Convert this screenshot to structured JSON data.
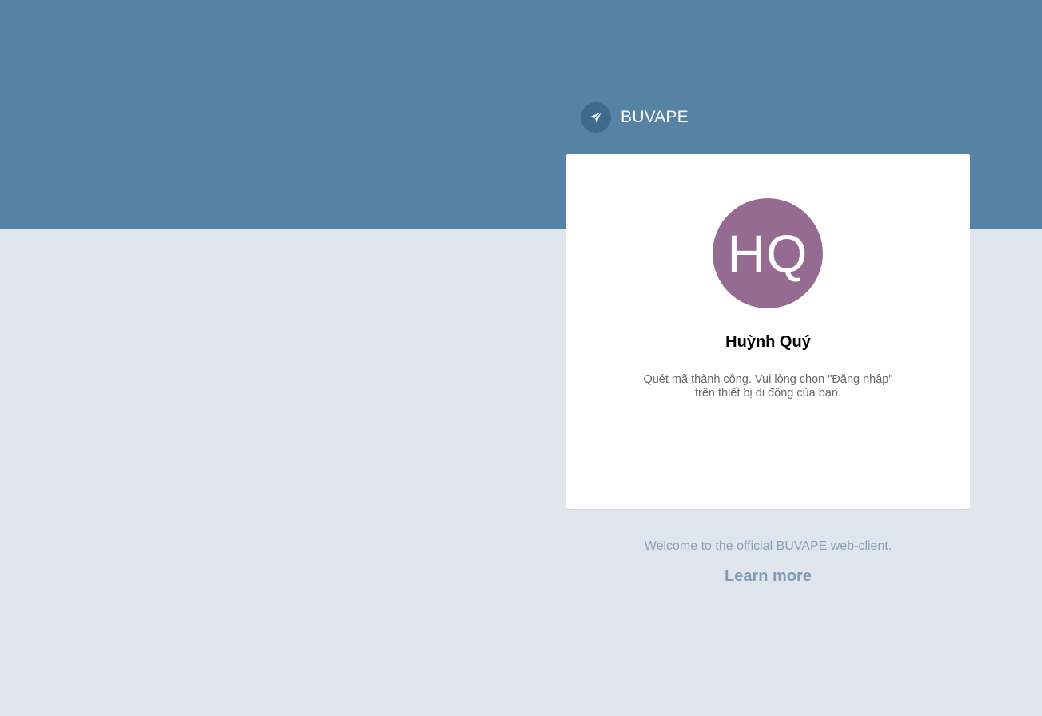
{
  "header": {
    "brand_name": "BUVAPE",
    "logo_icon": "paper-plane-icon",
    "background_color": "#5682a3"
  },
  "login_card": {
    "avatar_initials": "HQ",
    "avatar_color": "#956b92",
    "user_name": "Huỳnh Quý",
    "status_line_1": "Quét mã thành công. Vui lòng chọn \"Đăng nhập\"",
    "status_line_2": "trên thiết bị di động của bạn."
  },
  "footer": {
    "welcome_text": "Welcome to the official BUVAPE web-client.",
    "learn_more_label": "Learn more"
  }
}
